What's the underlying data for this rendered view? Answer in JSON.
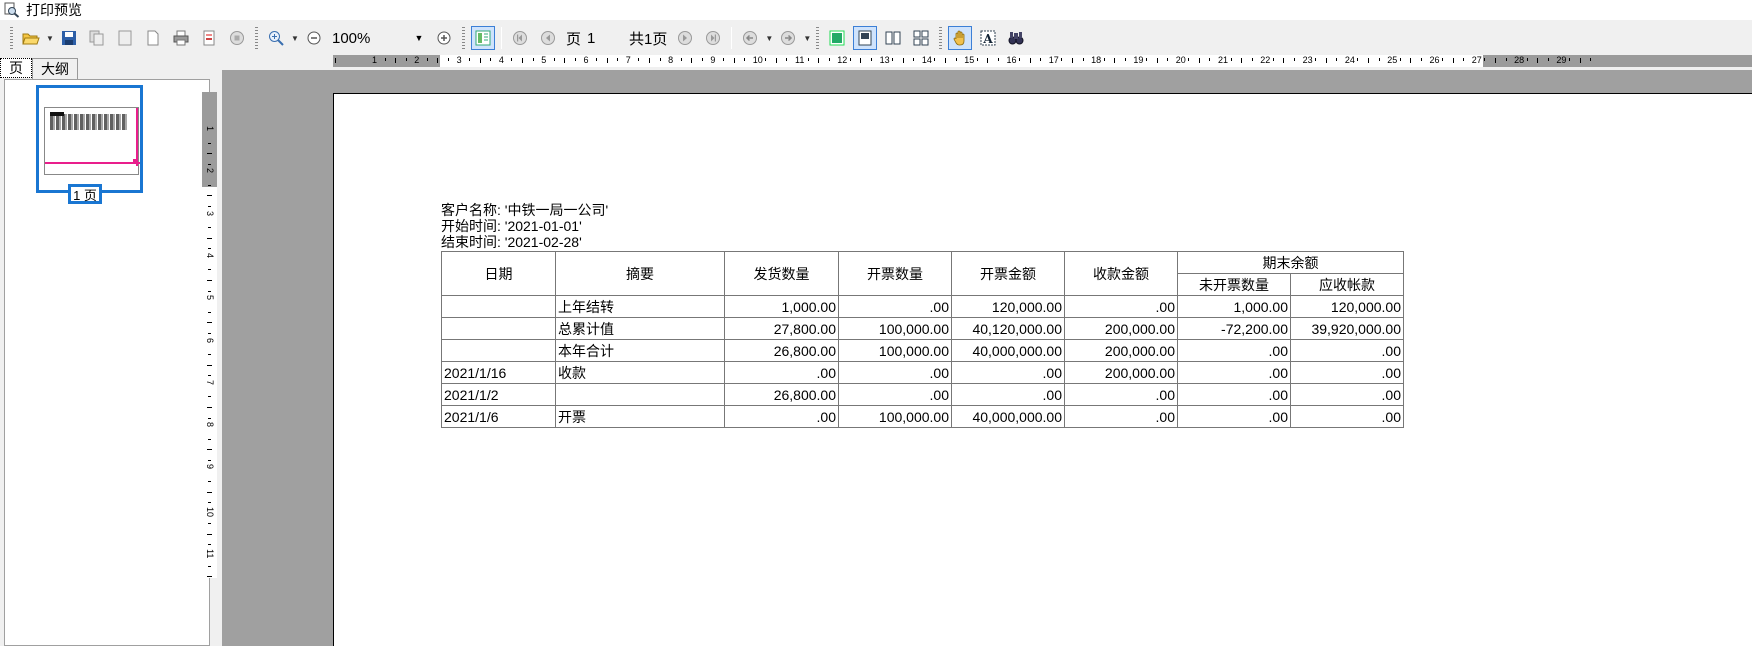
{
  "window": {
    "title": "打印预览"
  },
  "toolbar": {
    "zoom_value": "100%",
    "page_label": "页",
    "page_value": "1",
    "total_pages": "共1页"
  },
  "left_panel": {
    "tabs": [
      "页",
      "大纲"
    ],
    "thumb_label": "1 页"
  },
  "report": {
    "customer": "客户名称: '中铁一局一公司'",
    "start": "开始时间: '2021-01-01'",
    "end": "结束时间: '2021-02-28'",
    "headers": {
      "date": "日期",
      "summary": "摘要",
      "ship_qty": "发货数量",
      "inv_qty": "开票数量",
      "inv_amt": "开票金额",
      "recv_amt": "收款金额",
      "closing": "期末余额",
      "uninv_qty": "未开票数量",
      "receivable": "应收帐款"
    },
    "rows": [
      [
        "",
        "上年结转",
        "1,000.00",
        ".00",
        "120,000.00",
        ".00",
        "1,000.00",
        "120,000.00"
      ],
      [
        "",
        "总累计值",
        "27,800.00",
        "100,000.00",
        "40,120,000.00",
        "200,000.00",
        "-72,200.00",
        "39,920,000.00"
      ],
      [
        "",
        "本年合计",
        "26,800.00",
        "100,000.00",
        "40,000,000.00",
        "200,000.00",
        ".00",
        ".00"
      ],
      [
        "2021/1/16",
        "收款",
        ".00",
        ".00",
        ".00",
        "200,000.00",
        ".00",
        ".00"
      ],
      [
        "2021/1/2",
        "",
        "26,800.00",
        ".00",
        ".00",
        ".00",
        ".00",
        ".00"
      ],
      [
        "2021/1/6",
        "开票",
        ".00",
        "100,000.00",
        "40,000,000.00",
        ".00",
        ".00",
        ".00"
      ]
    ]
  },
  "rulers": {
    "h_numbers": [
      "1",
      "2",
      "3",
      "4",
      "5",
      "6",
      "7",
      "8",
      "9",
      "10",
      "11",
      "12",
      "13",
      "14",
      "15",
      "16",
      "17",
      "18",
      "19",
      "20",
      "21",
      "22",
      "23",
      "24",
      "25",
      "26",
      "27",
      "28",
      "29"
    ],
    "v_numbers": [
      "1",
      "2",
      "3",
      "4",
      "5",
      "6",
      "7",
      "8",
      "9",
      "10",
      "11"
    ]
  }
}
